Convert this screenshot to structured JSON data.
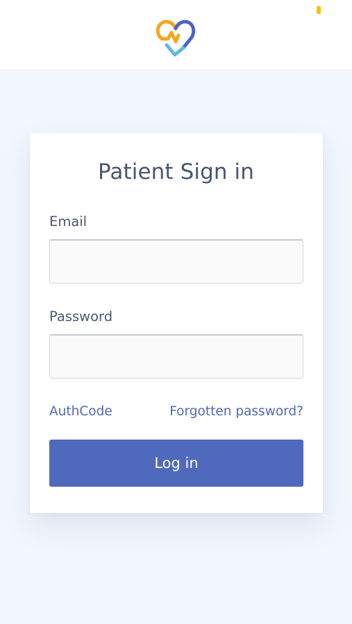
{
  "header": {
    "logo_icon": "heart-checkmark-logo-icon",
    "status_indicator_color": "#f5c400"
  },
  "login_card": {
    "title": "Patient Sign in",
    "email": {
      "label": "Email",
      "value": "",
      "placeholder": ""
    },
    "password": {
      "label": "Password",
      "value": "",
      "placeholder": ""
    },
    "authcode_link": "AuthCode",
    "forgot_password_link": "Forgotten password?",
    "login_button": "Log in"
  },
  "colors": {
    "page_background": "#f2f6fd",
    "accent": "#4f68bc",
    "button_background": "#4f69bd",
    "logo_orange": "#f2a623",
    "logo_blue": "#4a63c2",
    "logo_light_blue": "#5cb8e6"
  }
}
